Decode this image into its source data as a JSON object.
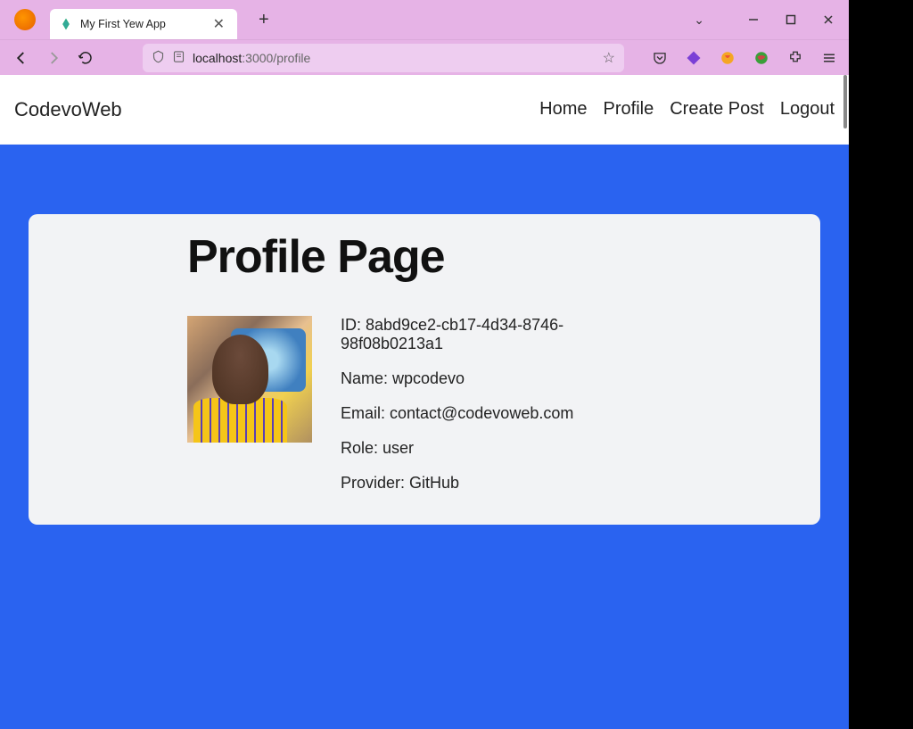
{
  "browser": {
    "tab_title": "My First Yew App",
    "url_host": "localhost",
    "url_path": ":3000/profile"
  },
  "app": {
    "brand": "CodevoWeb",
    "nav": {
      "home": "Home",
      "profile": "Profile",
      "create_post": "Create Post",
      "logout": "Logout"
    }
  },
  "page": {
    "title": "Profile Page",
    "profile": {
      "id_label": "ID: 8abd9ce2-cb17-4d34-8746-98f08b0213a1",
      "name_label": "Name: wpcodevo",
      "email_label": "Email: contact@codevoweb.com",
      "role_label": "Role: user",
      "provider_label": "Provider: GitHub"
    }
  }
}
